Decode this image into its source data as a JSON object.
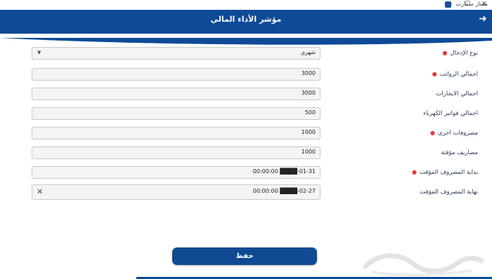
{
  "window": {
    "title": "مسار سمارت",
    "minimize": "—",
    "maximize": "☐",
    "close": "✕"
  },
  "header": {
    "title": "مؤشر الأداء المالي",
    "back_icon": "arrow-right-icon"
  },
  "form": {
    "entry_type": {
      "label": "نوع الإدخال",
      "required": true,
      "value": "شهري"
    },
    "total_salaries": {
      "label": "اجمالي الرواتب",
      "required": true,
      "value": "3000"
    },
    "total_rents": {
      "label": "اجمالي الايجارات",
      "required": false,
      "value": "3000"
    },
    "total_electricity": {
      "label": "اجمالي فواتير الكهرباء",
      "required": false,
      "value": "500"
    },
    "other_expenses": {
      "label": "مصروفات اخرى",
      "required": true,
      "value": "1000"
    },
    "temp_expenses": {
      "label": "مصاريف مؤقتة",
      "required": false,
      "value": "1000"
    },
    "temp_start": {
      "label": "بداية المصروف المؤقت",
      "required": true,
      "value": "00:00:00 ████-01-31"
    },
    "temp_end": {
      "label": "نهاية المصروف المؤقت",
      "required": false,
      "value": "00:00:00 ████-02-27"
    }
  },
  "actions": {
    "save_label": "حفظ"
  },
  "colors": {
    "primary": "#0e4a96",
    "required_dot": "#e23b3b"
  }
}
